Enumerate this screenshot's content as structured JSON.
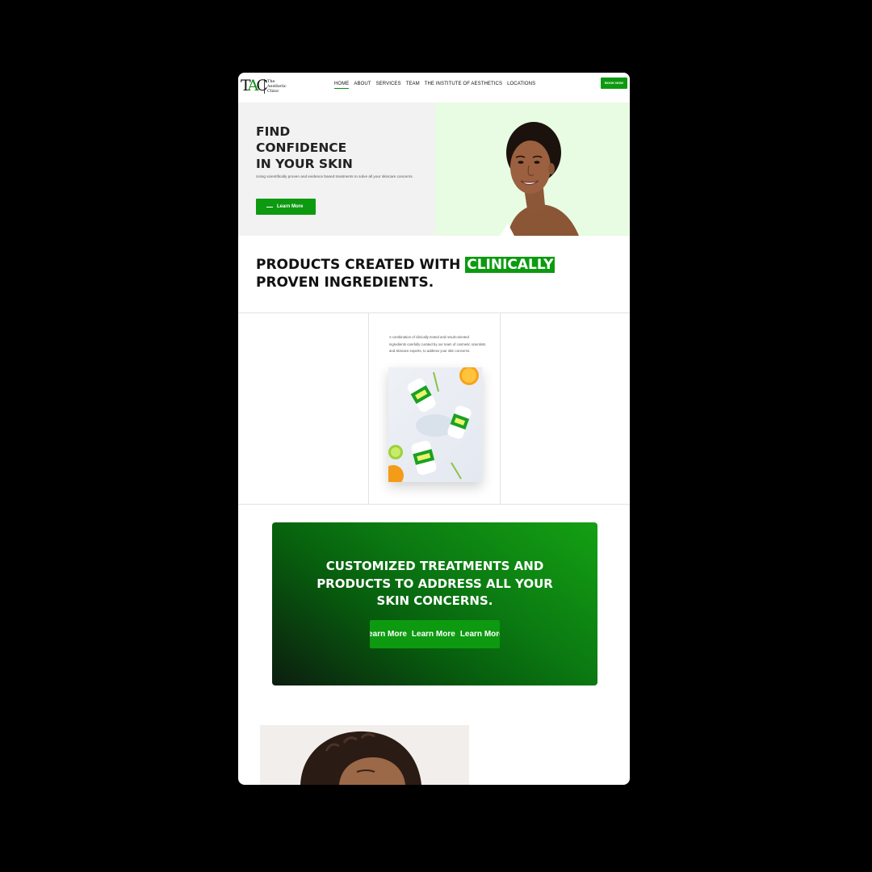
{
  "nav": {
    "logo_mark_1": "T",
    "logo_mark_2": "A",
    "logo_mark_3": "C",
    "logo_text": "The Aesthetic Clinic",
    "items": [
      {
        "label": "HOME",
        "active": true
      },
      {
        "label": "ABOUT",
        "active": false
      },
      {
        "label": "SERVICES",
        "active": false
      },
      {
        "label": "TEAM",
        "active": false
      },
      {
        "label": "THE INSTITUTE OF AESTHETICS",
        "active": false
      },
      {
        "label": "LOCATIONS",
        "active": false
      }
    ],
    "book_label": "BOOK NOW"
  },
  "hero": {
    "title_line1": "FIND",
    "title_line2": "CONFIDENCE",
    "title_line3": "IN YOUR SKIN",
    "subtitle": "Using scientifically proven and evidence based treatments to solve all your skincare concerns.",
    "button_label": "Learn More"
  },
  "products": {
    "heading_prefix": "PRODUCTS CREATED WITH ",
    "heading_highlight": "CLINICALLY",
    "heading_suffix": "PROVEN INGREDIENTS.",
    "description": "A combination of clinically tested and result-oriented ingredients carefully curated by our team of cosmetic scientists and skincare experts, to address your skin concerns."
  },
  "cta": {
    "title": "CUSTOMIZED TREATMENTS AND PRODUCTS TO ADDRESS ALL YOUR SKIN CONCERNS.",
    "button_repeats": [
      "Learn More",
      "Learn More",
      "Learn More"
    ]
  },
  "colors": {
    "accent": "#0d9a10",
    "hero_right_bg": "#e8fbe3",
    "hero_left_bg": "#f2f2f2",
    "page_bg": "#000000"
  }
}
